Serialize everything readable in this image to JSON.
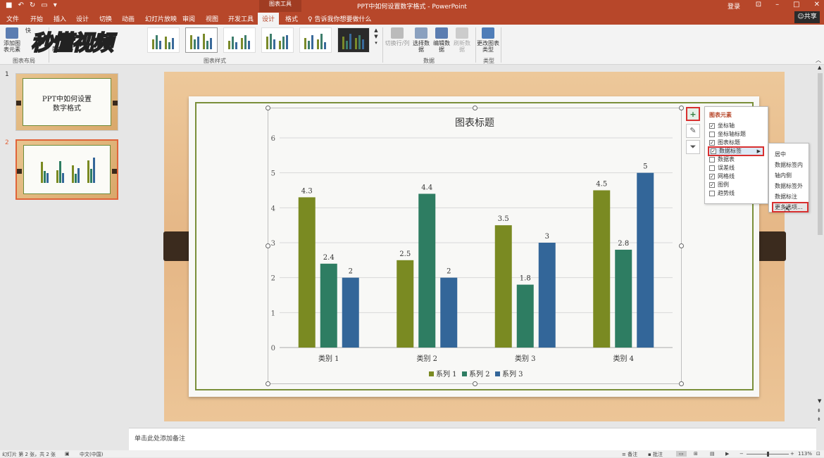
{
  "titlebar": {
    "doc_title": "PPT中如何设置数字格式 - PowerPoint",
    "context_group": "图表工具",
    "login": "登录",
    "share": "共享"
  },
  "tabs": [
    "文件",
    "开始",
    "插入",
    "设计",
    "切换",
    "动画",
    "幻灯片放映",
    "审阅",
    "视图",
    "开发工具",
    "设计",
    "格式"
  ],
  "active_tab_index": 10,
  "tell_me": "告诉我你想要做什么",
  "ribbon": {
    "add_element": "添加图表元素",
    "quick": "快",
    "colors": "颜色",
    "switch_row_col": "切换行/列",
    "select_data": "选择数据",
    "edit_data": "编辑数据",
    "refresh_data": "刷新数据",
    "change_type": "更改图表类型",
    "groups": {
      "layout": "图表布局",
      "styles": "图表样式",
      "data": "数据",
      "type": "类型"
    }
  },
  "watermark": "秒懂视频",
  "slides": [
    {
      "number": "1",
      "title": "PPT中如何设置\n数字格式"
    },
    {
      "number": "2",
      "title": ""
    }
  ],
  "chart_data": {
    "type": "bar",
    "title": "图表标题",
    "categories": [
      "类别 1",
      "类别 2",
      "类别 3",
      "类别 4"
    ],
    "series": [
      {
        "name": "系列 1",
        "values": [
          4.3,
          2.5,
          3.5,
          4.5
        ],
        "color": "#7a8a22"
      },
      {
        "name": "系列 2",
        "values": [
          2.4,
          4.4,
          1.8,
          2.8
        ],
        "color": "#2e7d62"
      },
      {
        "name": "系列 3",
        "values": [
          2,
          2,
          3,
          5
        ],
        "color": "#336699"
      }
    ],
    "ylim": [
      0,
      6
    ],
    "yticks": [
      "0",
      "1",
      "2",
      "3",
      "4",
      "5",
      "6"
    ],
    "grid": true,
    "legend": "bottom",
    "data_labels": true
  },
  "chart_elements_panel": {
    "header": "图表元素",
    "items": [
      {
        "label": "坐标轴",
        "checked": true
      },
      {
        "label": "坐标轴标题",
        "checked": false
      },
      {
        "label": "图表标题",
        "checked": true
      },
      {
        "label": "数据标签",
        "checked": true,
        "highlight": true
      },
      {
        "label": "数据表",
        "checked": false
      },
      {
        "label": "误差线",
        "checked": false
      },
      {
        "label": "网格线",
        "checked": true
      },
      {
        "label": "图例",
        "checked": true
      },
      {
        "label": "趋势线",
        "checked": false
      }
    ]
  },
  "data_label_submenu": [
    "居中",
    "数据标签内",
    "轴内侧",
    "数据标签外",
    "数据标注",
    "更多选项..."
  ],
  "notes_placeholder": "单击此处添加备注",
  "status": {
    "slide_info": "幻灯片 第 2 张，共 2 张",
    "language": "中文(中国)",
    "notes": "备注",
    "comments": "批注",
    "zoom": "113%"
  }
}
